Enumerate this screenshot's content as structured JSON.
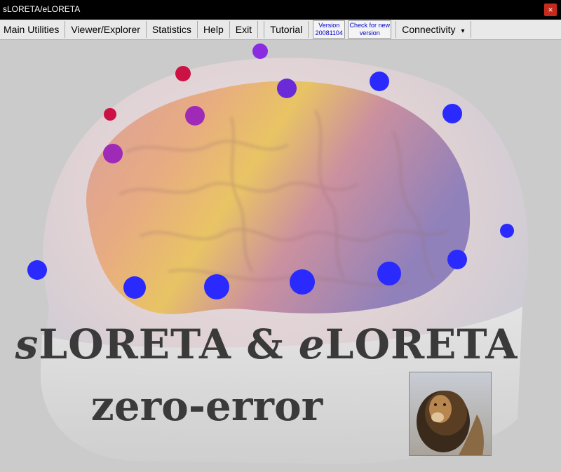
{
  "window": {
    "title": "sLORETA/eLORETA",
    "close_glyph": "×"
  },
  "menubar": {
    "items": [
      {
        "label": "Main Utilities"
      },
      {
        "label": "Viewer/Explorer"
      },
      {
        "label": "Statistics"
      },
      {
        "label": "Help"
      },
      {
        "label": "Exit"
      },
      {
        "label": "Tutorial"
      }
    ],
    "version_line1": "Version",
    "version_line2": "20081104",
    "check_line1": "Check for new",
    "check_line2": "version",
    "connectivity_label": "Connectivity",
    "connectivity_caret": "▾"
  },
  "splash": {
    "line1_s": "s",
    "line1_mid": "LORETA & ",
    "line1_e": "e",
    "line1_end": "LORETA",
    "line2": "zero-error"
  },
  "colors": {
    "electrode_blue": "#2a2aff",
    "electrode_purple": "#8a2be2",
    "electrode_red": "#cc1144",
    "text_dark": "#3a3a3a"
  }
}
